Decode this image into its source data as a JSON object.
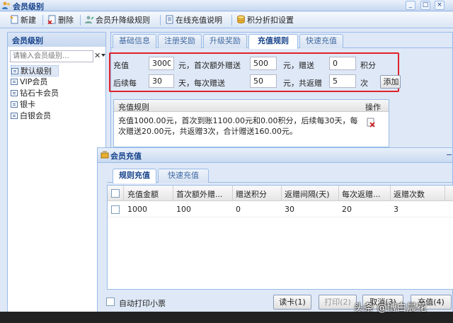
{
  "window": {
    "title": "会员级别"
  },
  "toolbar": {
    "new": "新建",
    "delete": "删除",
    "upgrade_rules": "会员升降级规则",
    "online_recharge_help": "在线充值说明",
    "points_discount": "积分折扣设置"
  },
  "left_panel": {
    "header": "会员级别",
    "search_placeholder": "请输入会员级别...",
    "items": [
      "默认级别",
      "VIP会员",
      "钻石卡会员",
      "银卡",
      "白银会员"
    ]
  },
  "tabs": [
    "基础信息",
    "注册奖励",
    "升级奖励",
    "充值规则",
    "快速充值"
  ],
  "active_tab": "充值规则",
  "recharge_form": {
    "label_recharge": "充值",
    "recharge_value": "3000",
    "label_first_bonus": "元，首次额外赠送",
    "first_bonus_value": "500",
    "label_gift": "元，赠送",
    "gift_points_value": "0",
    "label_points": "积分",
    "label_every": "后续每",
    "every_days_value": "30",
    "label_each_gift": "天，每次赠送",
    "each_gift_value": "50",
    "label_total": "元，共返赠",
    "total_times_value": "5",
    "label_times": "次",
    "add_button": "添加"
  },
  "rules_grid": {
    "col_rule": "充值规则",
    "col_action": "操作",
    "rule_text": "充值1000.00元，首次到账1100.00元和0.00积分，后续每30天，每次赠送20.00元，共返赠3次，合计赠送160.00元。"
  },
  "dialog": {
    "title": "会员充值",
    "tabs": [
      "规则充值",
      "快速充值"
    ],
    "columns": [
      "充值金额",
      "首次额外赠...",
      "赠送积分",
      "返赠间隔(天)",
      "每次返赠...",
      "返赠次数"
    ],
    "rows": [
      [
        "1000",
        "100",
        "0",
        "30",
        "20",
        "3"
      ]
    ],
    "auto_print": "自动打印小票",
    "buttons": {
      "read_card": "读卡(1)",
      "print": "打印(2)",
      "cancel": "取消(3)",
      "recharge": "充值(4)"
    }
  },
  "watermark": "头条 @博白晨花",
  "colors": {
    "highlight_box": "#e0222a",
    "accent": "#15428b"
  }
}
